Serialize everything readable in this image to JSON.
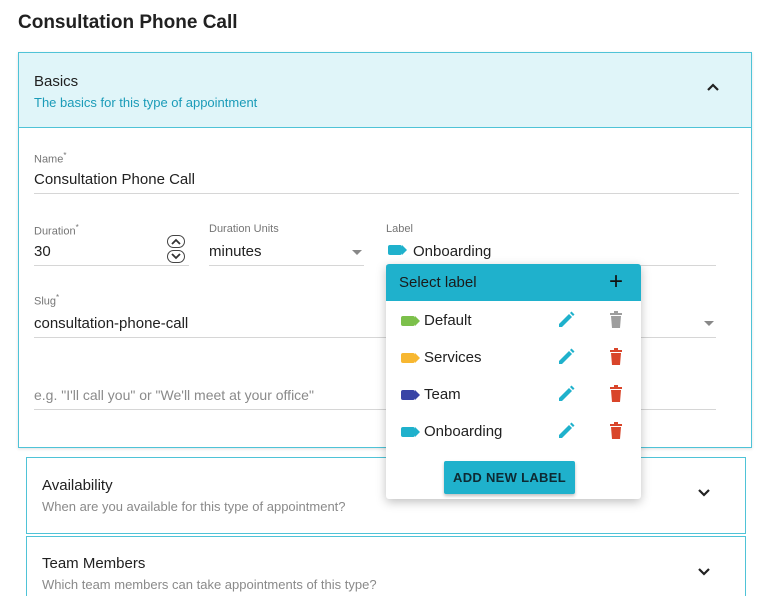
{
  "page": {
    "title": "Consultation Phone Call"
  },
  "basics": {
    "title": "Basics",
    "subtitle": "The basics for this type of appointment",
    "name_label": "Name",
    "name_value": "Consultation Phone Call",
    "duration_label": "Duration",
    "duration_value": "30",
    "units_label": "Duration Units",
    "units_value": "minutes",
    "label_label": "Label",
    "label_value": "Onboarding",
    "slug_label": "Slug",
    "slug_value": "consultation-phone-call",
    "location_placeholder": "e.g. \"I'll call you\" or \"We'll meet at your office\"",
    "required_mark": "*"
  },
  "availability": {
    "title": "Availability",
    "subtitle": "When are you available for this type of appointment?"
  },
  "team_members": {
    "title": "Team Members",
    "subtitle": "Which team members can take appointments of this type?"
  },
  "label_popup": {
    "header": "Select label",
    "add_symbol": "+",
    "add_button": "ADD NEW LABEL",
    "labels": [
      {
        "name": "Default",
        "color": "#7cc04b",
        "deletable": false
      },
      {
        "name": "Services",
        "color": "#f7b731",
        "deletable": true
      },
      {
        "name": "Team",
        "color": "#3944a6",
        "deletable": true
      },
      {
        "name": "Onboarding",
        "color": "#1fb1cc",
        "deletable": true
      }
    ]
  },
  "colors": {
    "accent": "#1fb1cc",
    "delete": "#d9452a",
    "delete_disabled": "#9e9e9e",
    "panel_header_bg": "#e0f5f9"
  }
}
